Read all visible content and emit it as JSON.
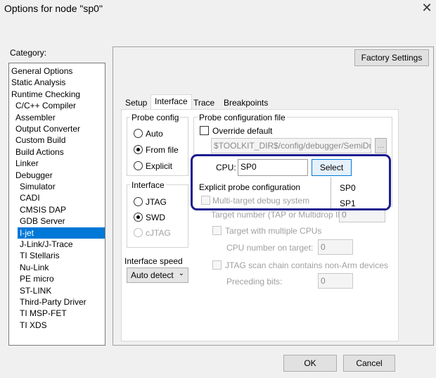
{
  "window": {
    "title": "Options for node \"sp0\"",
    "close_glyph": "✕"
  },
  "category": {
    "label": "Category:",
    "items": [
      "General Options",
      "Static Analysis",
      "Runtime Checking",
      "C/C++ Compiler",
      "Assembler",
      "Output Converter",
      "Custom Build",
      "Build Actions",
      "Linker",
      "Debugger",
      "Simulator",
      "CADI",
      "CMSIS DAP",
      "GDB Server",
      "I-jet",
      "J-Link/J-Trace",
      "TI Stellaris",
      "Nu-Link",
      "PE micro",
      "ST-LINK",
      "Third-Party Driver",
      "TI MSP-FET",
      "TI XDS"
    ],
    "selected": "I-jet"
  },
  "factory_settings_label": "Factory Settings",
  "tabs": [
    "Setup",
    "Interface",
    "Trace",
    "Breakpoints"
  ],
  "active_tab": "Interface",
  "probe_config": {
    "label": "Probe config",
    "options": [
      "Auto",
      "From file",
      "Explicit"
    ],
    "selected": "From file"
  },
  "interface": {
    "label": "Interface",
    "options": [
      "JTAG",
      "SWD",
      "cJTAG"
    ],
    "selected": "SWD"
  },
  "interface_speed": {
    "label": "Interface speed",
    "value": "Auto detect"
  },
  "probe_file": {
    "label": "Probe configuration file",
    "override_label": "Override default",
    "path": "$TOOLKIT_DIR$/config/debugger/SemiDrive/",
    "browse_label": "..."
  },
  "cpu": {
    "label": "CPU:",
    "value": "SP0",
    "select_label": "Select",
    "options": [
      "SP0",
      "SP1"
    ]
  },
  "explicit": {
    "label": "Explicit probe configuration",
    "multi_target_label": "Multi-target debug system",
    "target_number_label": "Target number (TAP or Multidrop ID):",
    "target_number_value": "0",
    "multi_cpu_label": "Target with multiple CPUs",
    "cpu_number_label": "CPU number on target:",
    "cpu_number_value": "0",
    "jtag_chain_label": "JTAG scan chain contains non-Arm devices",
    "preceding_bits_label": "Preceding bits:",
    "preceding_bits_value": "0"
  },
  "buttons": {
    "ok": "OK",
    "cancel": "Cancel"
  },
  "colors": {
    "accent": "#0078d7",
    "popup_border": "#1d1c8f",
    "disabled_text": "#a0a0a0"
  }
}
